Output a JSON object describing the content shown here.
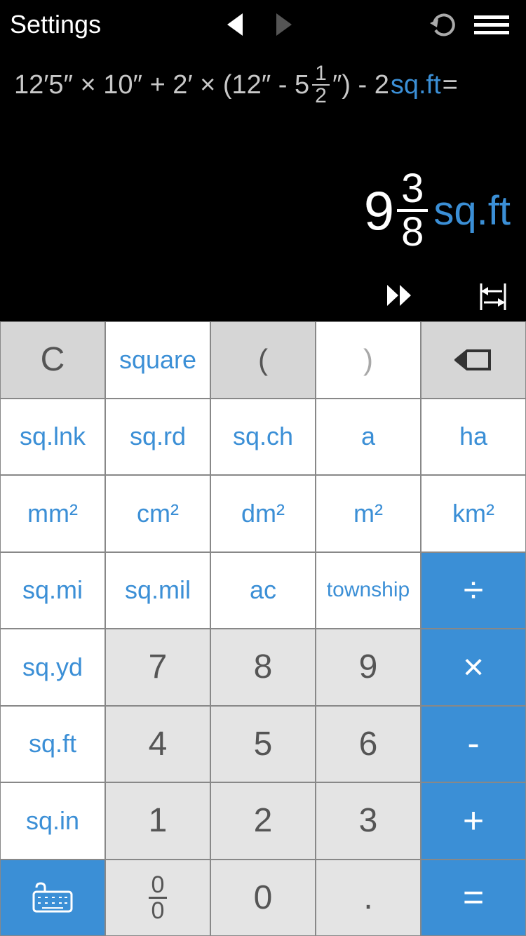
{
  "topbar": {
    "settings": "Settings"
  },
  "display": {
    "expression": {
      "p1": "12′5″ × 10″ + 2′ × (12″ - 5",
      "frac_num": "1",
      "frac_den": "2",
      "p2": "″) - 2",
      "unit": "sq.ft",
      "p3": " ="
    },
    "result": {
      "whole": "9",
      "frac_num": "3",
      "frac_den": "8",
      "unit": "sq.ft"
    }
  },
  "keys": {
    "clear": "C",
    "square": "square",
    "lparen": "(",
    "rparen": ")",
    "r2c1": "sq.lnk",
    "r2c2": "sq.rd",
    "r2c3": "sq.ch",
    "r2c4": "a",
    "r2c5": "ha",
    "r3c1": "mm²",
    "r3c2": "cm²",
    "r3c3": "dm²",
    "r3c4": "m²",
    "r3c5": "km²",
    "r4c1": "sq.mi",
    "r4c2": "sq.mil",
    "r4c3": "ac",
    "r4c4": "township",
    "r5c1": "sq.yd",
    "n7": "7",
    "n8": "8",
    "n9": "9",
    "r6c1": "sq.ft",
    "n4": "4",
    "n5": "5",
    "n6": "6",
    "r7c1": "sq.in",
    "n1": "1",
    "n2": "2",
    "n3": "3",
    "n0": "0",
    "dot": ".",
    "divide": "÷",
    "multiply": "×",
    "minus": "-",
    "plus": "+",
    "equals": "=",
    "frac_top": "0",
    "frac_bot": "0"
  }
}
